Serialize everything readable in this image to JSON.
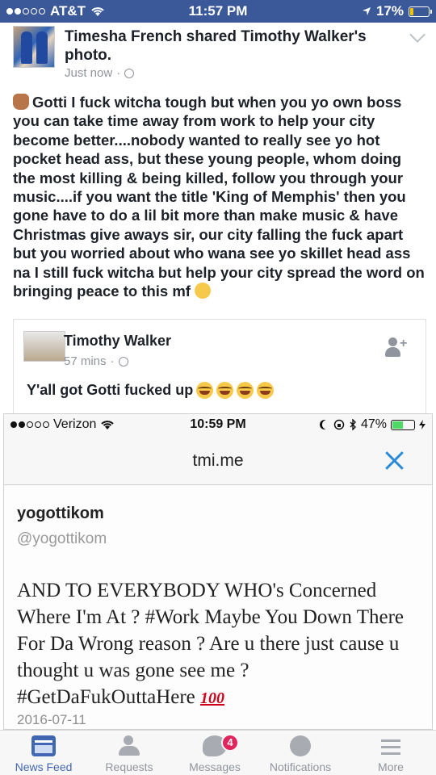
{
  "status_bar": {
    "carrier": "AT&T",
    "time": "11:57 PM",
    "battery": "17%"
  },
  "post": {
    "shared_line": "Timesha French shared Timothy Walker's photo.",
    "meta_time": "Just now",
    "text": "Gotti I fuck witcha tough but when you yo own boss you can take time away from work to help your city become better....nobody wanted to really see yo hot pocket head ass, but these young people, whom doing the most killing & being killed, follow you through your music....if you want the title 'King of Memphis' then you gone have to do a lil bit more than make music & have Christmas give aways sir, our city falling the fuck apart but you worried about who wana see yo skillet head ass na I still fuck witcha but help your city spread the word on bringing peace to this mf"
  },
  "shared": {
    "name": "Timothy Walker",
    "meta_time": "57 mins",
    "text": "Y'all got Gotti fucked up"
  },
  "embedded": {
    "status": {
      "carrier": "Verizon",
      "time": "10:59 PM",
      "battery": "47%"
    },
    "browser_title": "tmi.me",
    "tweet": {
      "name": "yogottikom",
      "handle": "@yogottikom",
      "text": "AND TO EVERYBODY WHO's Concerned Where I'm At ? #Work Maybe You Down There For Da Wrong reason ? Are u there just cause u thought u was gone see me ? #GetDaFukOuttaHere",
      "hundred": "100",
      "date": "2016-07-11"
    }
  },
  "tabs": [
    {
      "label": "News Feed",
      "icon": "news-feed-icon",
      "active": true
    },
    {
      "label": "Requests",
      "icon": "friend-requests-icon"
    },
    {
      "label": "Messages",
      "icon": "messages-icon",
      "badge": "4"
    },
    {
      "label": "Notifications",
      "icon": "globe-icon"
    },
    {
      "label": "More",
      "icon": "menu-icon"
    }
  ],
  "colors": {
    "facebook_blue": "#3b5998",
    "accent_blue": "#4267b2",
    "badge_red": "#e0245e"
  }
}
